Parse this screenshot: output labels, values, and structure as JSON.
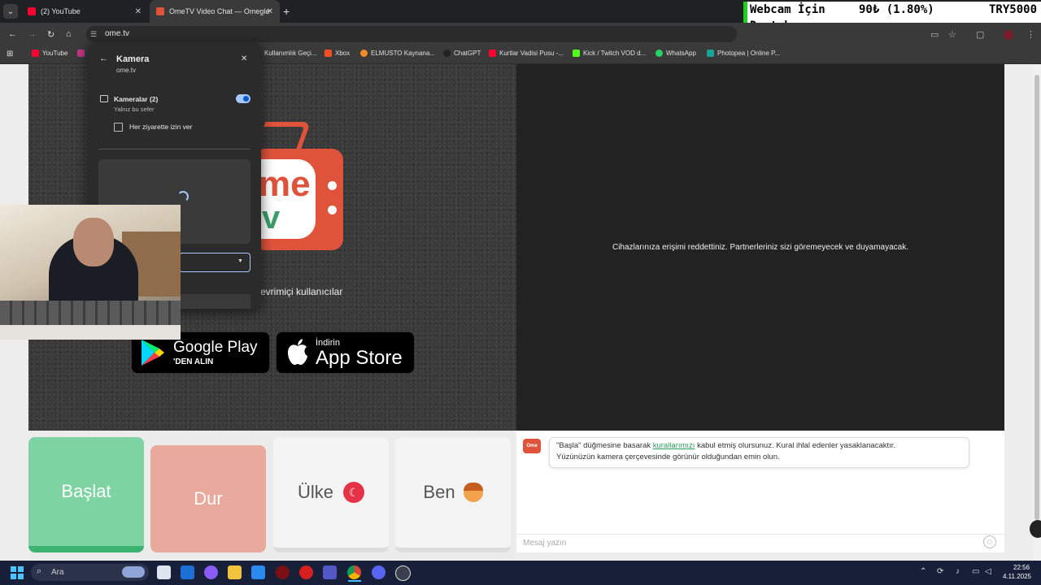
{
  "browser": {
    "tabs": [
      {
        "label": "(2) YouTube",
        "color": "#ff0033"
      },
      {
        "label": "OmeTV Video Chat — Omegle",
        "color": "#e0533b"
      }
    ],
    "url": "ome.tv",
    "bookmarks": [
      {
        "label": "YouTube",
        "color": "#ff0033"
      },
      {
        "label": "Kullanımlık Geçi...",
        "color": "#7a7a7a"
      },
      {
        "label": "Xbox",
        "color": "#f25022"
      },
      {
        "label": "ELMUSTO Kaynana...",
        "color": "#f28c28"
      },
      {
        "label": "ChatGPT",
        "color": "#222222"
      },
      {
        "label": "Kurtlar Vadisi Pusu -...",
        "color": "#ff0033"
      },
      {
        "label": "Kick / Twitch VOD d...",
        "color": "#53fc18"
      },
      {
        "label": "WhatsApp",
        "color": "#25d366"
      },
      {
        "label": "Photopea | Online P...",
        "color": "#18a497"
      }
    ]
  },
  "donation_widget": {
    "line1_left": "Webcam İçin",
    "line1_mid": "90₺ (1.80%)",
    "line1_right": "TRY5000",
    "line2": "Destek"
  },
  "permission_popup": {
    "title": "Kamera",
    "site": "ome.tv",
    "cameras_label": "Kameralar (2)",
    "once_label": "Yalnız bu sefer",
    "always_label": "Her ziyarette izin ver"
  },
  "page": {
    "logo_top": "me",
    "logo_bottom": "v",
    "online_text": "evrimiçi kullanıcılar",
    "google_play_name": "Google Play",
    "google_play_sub": "'DEN ALIN",
    "appstore_small": "İndirin",
    "appstore_name": "App Store",
    "denied_text": "Cihazlarınıza erişimi reddettiniz. Partnerleriniz sizi göremeyecek ve duyamayacak.",
    "buttons": {
      "start": "Başlat",
      "stop": "Dur",
      "country": "Ülke",
      "me": "Ben"
    }
  },
  "chat": {
    "logo_label": "Ome TV",
    "line1_pre": "\"Başla\" düğmesine basarak ",
    "line1_link": "kurallarımızı",
    "line1_post": " kabul etmiş olursunuz. Kural ihlal edenler yasaklanacaktır.",
    "line2": "Yüzünüzün kamera çerçevesinde görünür olduğundan emin olun.",
    "placeholder": "Mesaj yazın"
  },
  "taskbar": {
    "search_placeholder": "Ara",
    "time": "22:56",
    "date": "4.11.2025"
  }
}
